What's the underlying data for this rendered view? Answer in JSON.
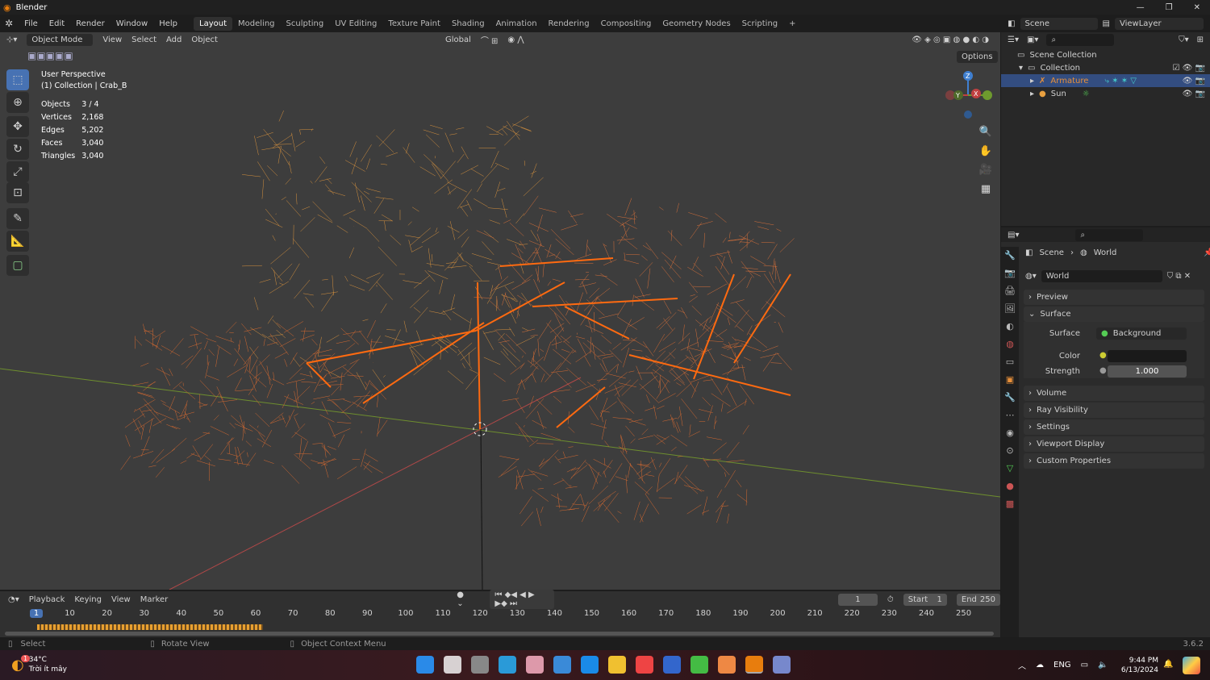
{
  "window": {
    "title": "Blender",
    "controls": [
      "—",
      "❐",
      "✕"
    ]
  },
  "menu": {
    "items": [
      "File",
      "Edit",
      "Render",
      "Window",
      "Help"
    ],
    "workspaces": [
      "Layout",
      "Modeling",
      "Sculpting",
      "UV Editing",
      "Texture Paint",
      "Shading",
      "Animation",
      "Rendering",
      "Compositing",
      "Geometry Nodes",
      "Scripting",
      "+"
    ],
    "active_workspace": "Layout",
    "scene": "Scene",
    "view_layer": "ViewLayer"
  },
  "viewport": {
    "mode": "Object Mode",
    "menus": [
      "View",
      "Select",
      "Add",
      "Object"
    ],
    "transform": "Global",
    "options": "Options",
    "overlay_title": "User Perspective",
    "overlay_sub": "(1) Collection | Crab_B",
    "stats": [
      [
        "Objects",
        "3 / 4"
      ],
      [
        "Vertices",
        "2,168"
      ],
      [
        "Edges",
        "5,202"
      ],
      [
        "Faces",
        "3,040"
      ],
      [
        "Triangles",
        "3,040"
      ]
    ],
    "gizmo": {
      "z": "Z",
      "y": "Y",
      "x": "X"
    },
    "colors": {
      "wire": "#e8903a",
      "bones": "#ff6a10",
      "x_axis": "#b04848",
      "y_axis": "#6e8e2e"
    }
  },
  "outliner": {
    "root": "Scene Collection",
    "collection": "Collection",
    "items": [
      {
        "name": "Armature",
        "icon": "armature-icon",
        "selected": true
      },
      {
        "name": "Sun",
        "icon": "light-icon",
        "selected": false
      }
    ]
  },
  "properties": {
    "breadcrumb": [
      "Scene",
      "World"
    ],
    "world_name": "World",
    "panels_top": [
      "Preview",
      "Surface"
    ],
    "surface_label": "Surface",
    "surface_value": "Background",
    "color_label": "Color",
    "strength_label": "Strength",
    "strength_value": "1.000",
    "panels": [
      "Volume",
      "Ray Visibility",
      "Settings",
      "Viewport Display",
      "Custom Properties"
    ]
  },
  "timeline": {
    "menus": [
      "Playback",
      "Keying",
      "View",
      "Marker"
    ],
    "current_frame": "1",
    "start_label": "Start",
    "start": "1",
    "end_label": "End",
    "end": "250",
    "ticks": [
      "1",
      "10",
      "20",
      "30",
      "40",
      "50",
      "60",
      "70",
      "80",
      "90",
      "100",
      "110",
      "120",
      "130",
      "140",
      "150",
      "160",
      "170",
      "180",
      "190",
      "200",
      "210",
      "220",
      "230",
      "240",
      "250"
    ]
  },
  "status": {
    "left": "Select",
    "middle": "Rotate View",
    "right": "Object Context Menu",
    "version": "3.6.2"
  },
  "taskbar": {
    "temp": "34°C",
    "weather": "Trời ít mây",
    "badge": "1",
    "lang": "ENG",
    "time": "9:44 PM",
    "date": "6/13/2024"
  }
}
